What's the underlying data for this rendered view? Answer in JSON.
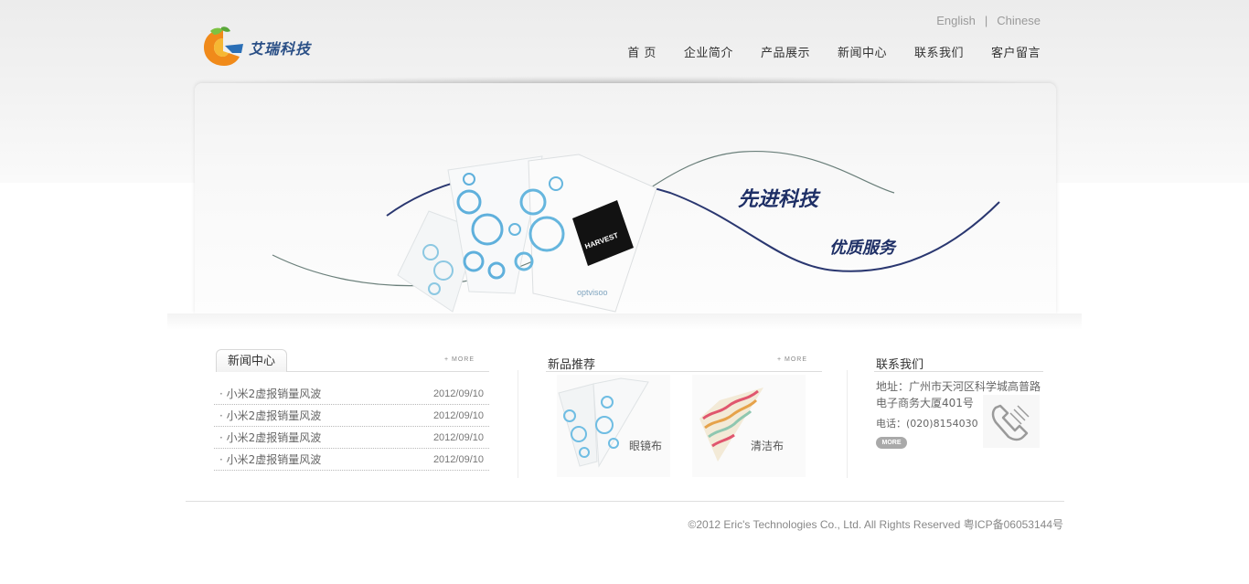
{
  "header": {
    "logo_text": "艾瑞科技",
    "lang_links": [
      "English",
      "Chinese"
    ],
    "lang_separator": "|",
    "nav": [
      "首 页",
      "企业简介",
      "产品展示",
      "新闻中心",
      "联系我们",
      "客户留言"
    ]
  },
  "banner": {
    "slogan_1": "先进科技",
    "slogan_2": "优质服务",
    "cloth_brand_1": "HARVEST",
    "cloth_brand_2": "optvisoo"
  },
  "news": {
    "title": "新闻中心",
    "more": "+ MORE",
    "items": [
      {
        "title": "小米2虚报销量风波",
        "date": "2012/09/10"
      },
      {
        "title": "小米2虚报销量风波",
        "date": "2012/09/10"
      },
      {
        "title": "小米2虚报销量风波",
        "date": "2012/09/10"
      },
      {
        "title": "小米2虚报销量风波",
        "date": "2012/09/10"
      }
    ]
  },
  "products": {
    "title": "新品推荐",
    "more": "+ MORE",
    "items": [
      {
        "label": "眼镜布"
      },
      {
        "label": "清洁布"
      }
    ]
  },
  "contact": {
    "title": "联系我们",
    "address_line1": "地址：广州市天河区科学城高普路",
    "address_line2": "电子商务大厦401号",
    "phone": "电话：(020)8154030",
    "more": "MORE"
  },
  "footer": {
    "copyright": "©2012 Eric's Technologies Co., Ltd. All Rights Reserved 粤ICP备06053144号"
  },
  "colors": {
    "nav_text": "#333333",
    "slogan": "#1e2f66",
    "logo_blue": "#2a4f86"
  }
}
